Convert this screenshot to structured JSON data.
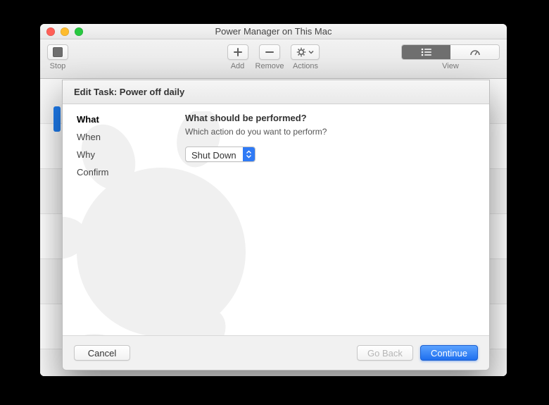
{
  "window": {
    "title": "Power Manager on This Mac"
  },
  "toolbar": {
    "stop_label": "Stop",
    "add_label": "Add",
    "remove_label": "Remove",
    "actions_label": "Actions",
    "view_label": "View"
  },
  "sheet": {
    "header_label": "Edit Task: Power off daily",
    "steps": [
      {
        "label": "What",
        "active": true
      },
      {
        "label": "When",
        "active": false
      },
      {
        "label": "Why",
        "active": false
      },
      {
        "label": "Confirm",
        "active": false
      }
    ],
    "content": {
      "heading": "What should be performed?",
      "subtext": "Which action do you want to perform?",
      "action_select": {
        "value": "Shut Down"
      }
    },
    "footer": {
      "cancel_label": "Cancel",
      "back_label": "Go Back",
      "continue_label": "Continue"
    }
  }
}
